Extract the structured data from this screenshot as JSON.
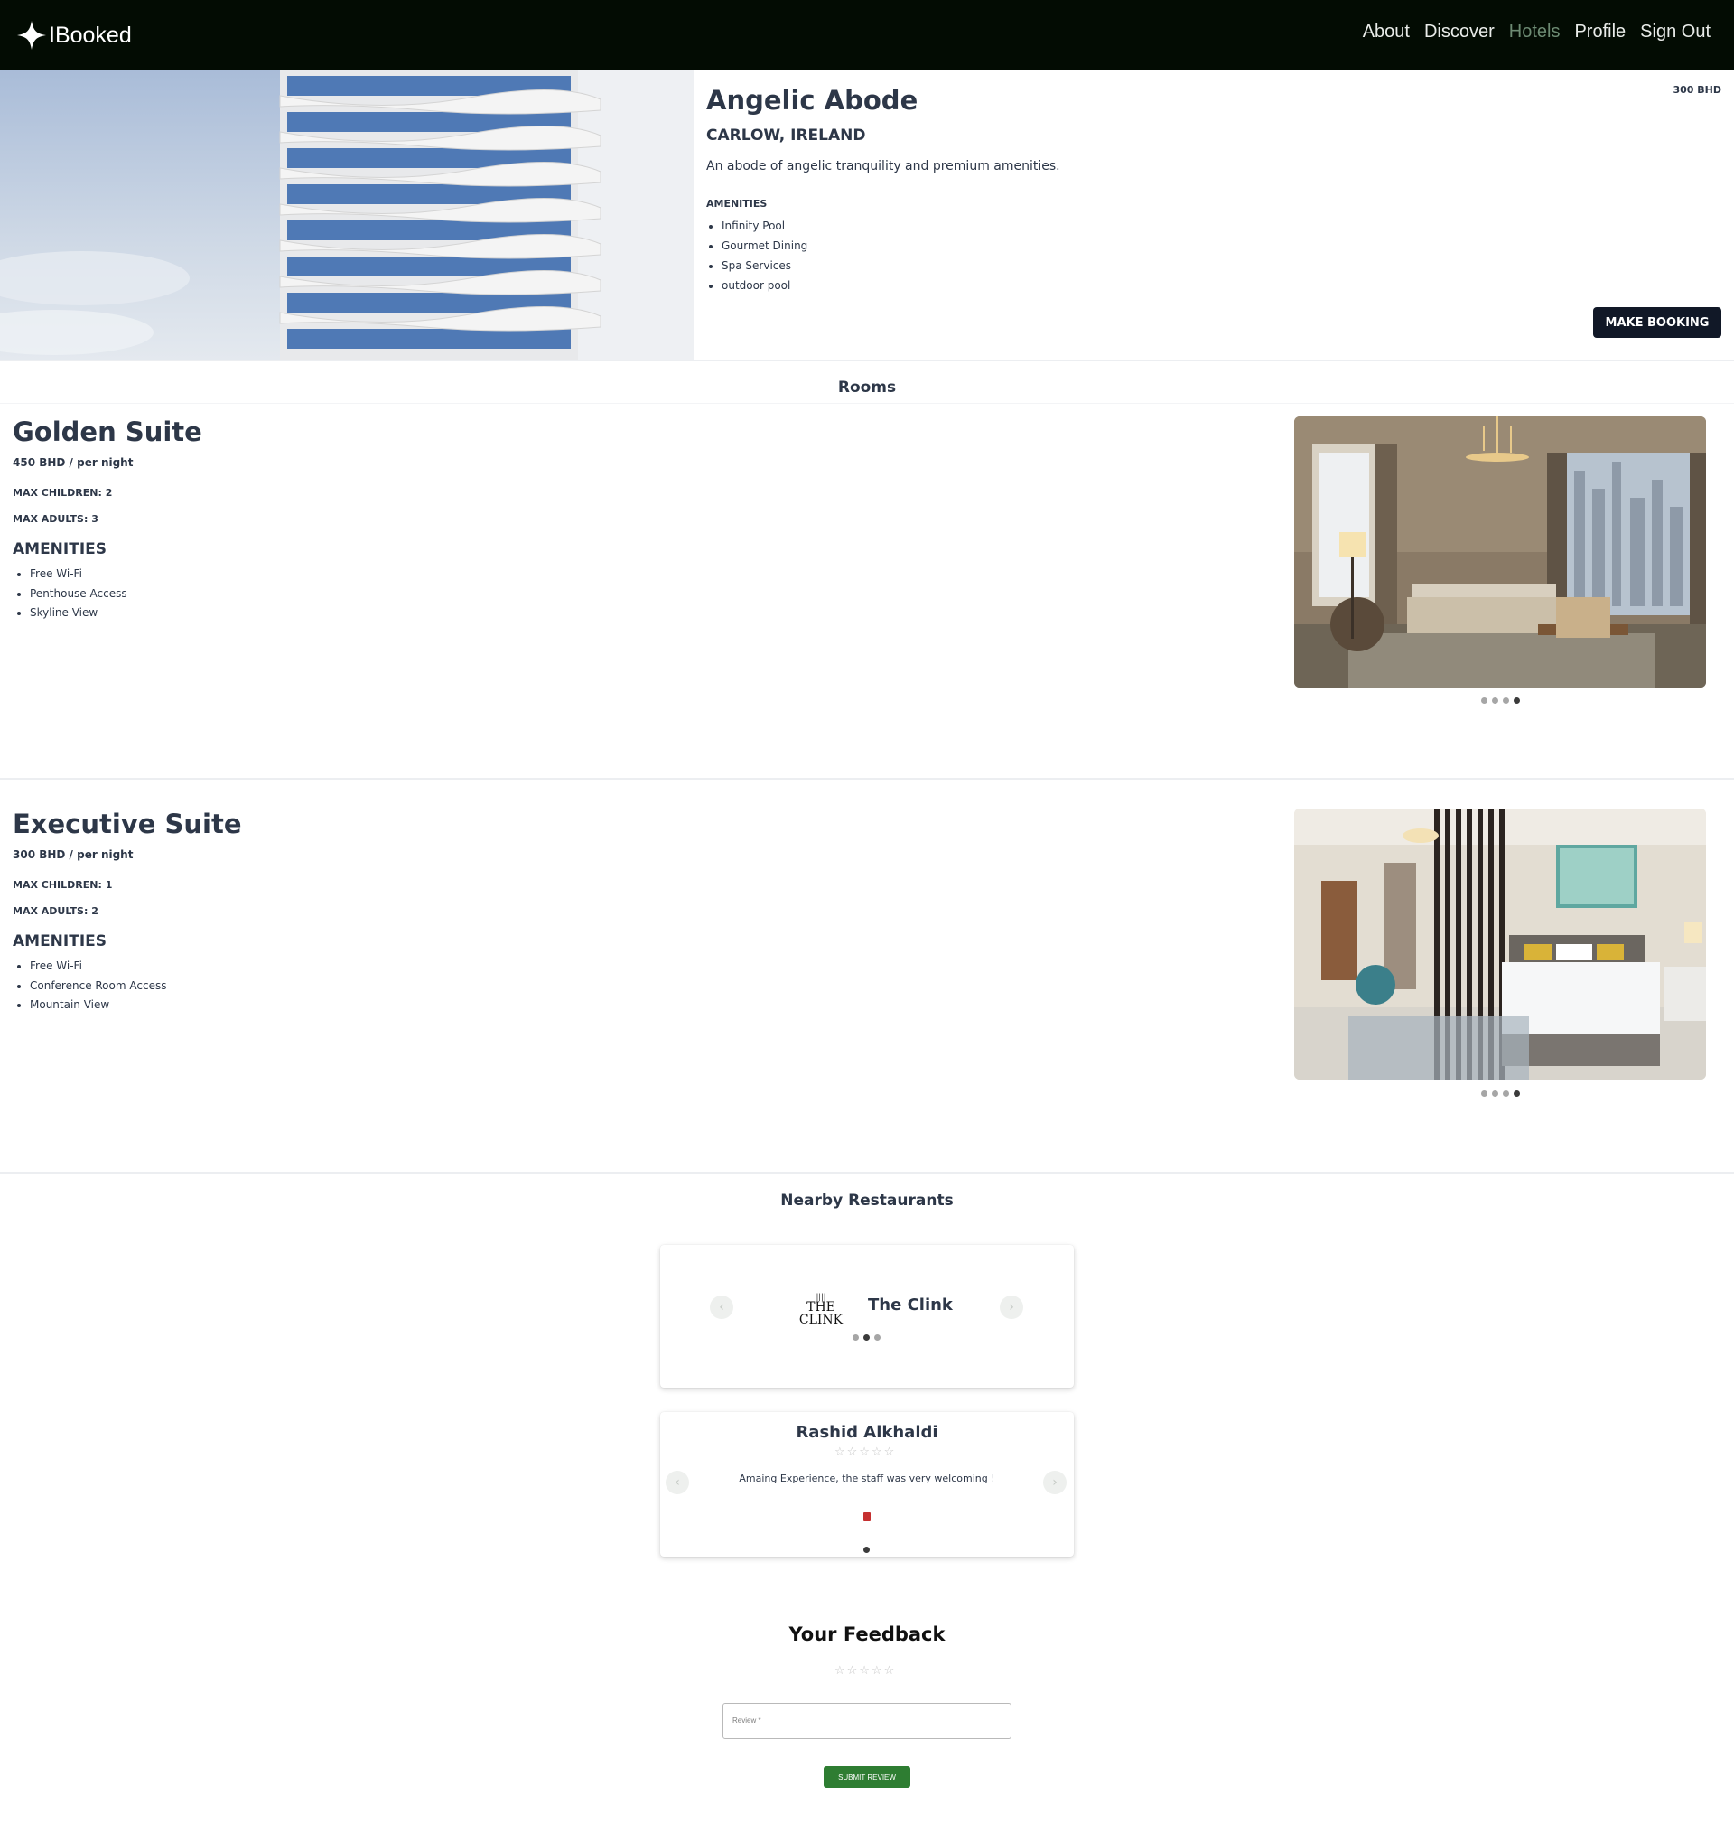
{
  "brand": {
    "name": "IBooked"
  },
  "nav": {
    "links": [
      "About",
      "Discover",
      "Hotels",
      "Profile",
      "Sign Out"
    ],
    "active": "Hotels"
  },
  "hotel": {
    "name": "Angelic Abode",
    "price": "300 BHD",
    "location": "CARLOW, IRELAND",
    "description": "An abode of angelic tranquility and premium amenities.",
    "amenities_title": "AMENITIES",
    "amenities": [
      "Infinity Pool",
      "Gourmet Dining",
      "Spa Services",
      "outdoor pool"
    ],
    "book_label": "MAKE BOOKING"
  },
  "rooms_title": "Rooms",
  "rooms": [
    {
      "name": "Golden Suite",
      "price": "450 BHD / per night",
      "max_children": "MAX CHILDREN: 2",
      "max_adults": "MAX ADULTS: 3",
      "amenities_title": "AMENITIES",
      "amenities": [
        "Free Wi-Fi",
        "Penthouse Access",
        "Skyline View"
      ],
      "carousel": {
        "count": 4,
        "active": 4
      }
    },
    {
      "name": "Executive Suite",
      "price": "300 BHD / per night",
      "max_children": "MAX CHILDREN: 1",
      "max_adults": "MAX ADULTS: 2",
      "amenities_title": "AMENITIES",
      "amenities": [
        "Free Wi-Fi",
        "Conference Room Access",
        "Mountain View"
      ],
      "carousel": {
        "count": 4,
        "active": 4
      }
    }
  ],
  "restaurants_title": "Nearby Restaurants",
  "restaurant": {
    "name": "The Clink",
    "logo_text": [
      "||||",
      "THE",
      "CLINK"
    ],
    "carousel": {
      "count": 3,
      "active": 2
    }
  },
  "review": {
    "author": "Rashid Alkhaldi",
    "rating": 0,
    "stars": "☆☆☆☆☆",
    "text": "Amaing Experience, the staff was very welcoming !",
    "carousel": {
      "count": 1,
      "active": 1
    }
  },
  "feedback": {
    "title": "Your Feedback",
    "stars": "☆☆☆☆☆",
    "placeholder": "Review *",
    "submit_label": "SUBMIT REVIEW"
  },
  "colors": {
    "nav_bg": "#030c03",
    "nav_active": "#6d8b73",
    "button_dark": "#111827",
    "submit_green": "#2e7d32",
    "delete_red": "#c53030"
  },
  "icons": {
    "logo": "diamond-star-icon",
    "prev": "chevron-left-icon",
    "next": "chevron-right-icon",
    "delete": "trash-icon",
    "rating": "star-outline-icon"
  }
}
